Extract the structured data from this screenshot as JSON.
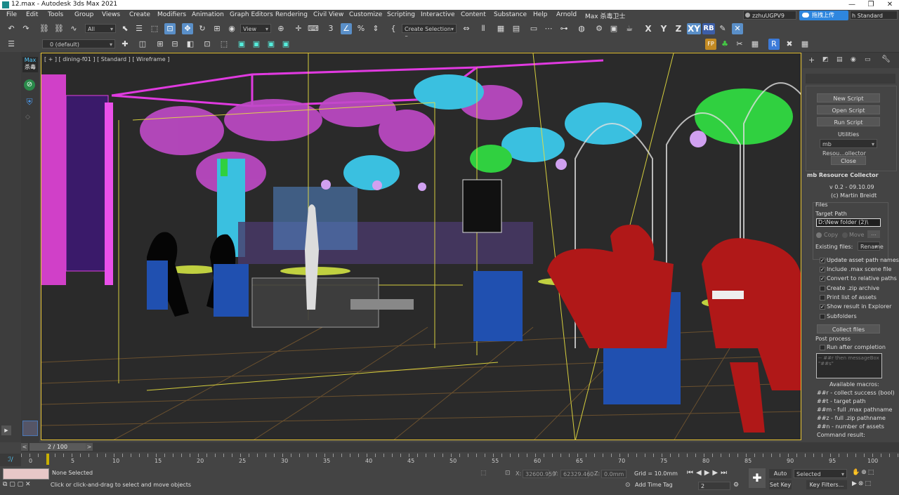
{
  "window": {
    "title": "12.max - Autodesk 3ds Max 2021",
    "min": "—",
    "restore": "❐",
    "close": "✕"
  },
  "menu": [
    "File",
    "Edit",
    "Tools",
    "Group",
    "Views",
    "Create",
    "Modifiers",
    "Animation",
    "Graph Editors",
    "Rendering",
    "Civil View",
    "Customize",
    "Scripting",
    "Interactive",
    "Content",
    "Substance",
    "Help",
    "Arnold",
    "Max 杀毒卫士"
  ],
  "user": {
    "name": "zzhuUGPV9",
    "upload_label": "拖拽上传",
    "workspace": "h Standard"
  },
  "toolbar": {
    "selection_filter": "All",
    "ref_coord": "View",
    "named_selection": "Create Selection Se",
    "axis_x": "X",
    "axis_y": "Y",
    "axis_z": "Z",
    "axis_xy": "XY",
    "rb": "RB",
    "layer_current": "0 (default)"
  },
  "left_strip": {
    "max_label": "Max",
    "antivirus_label": "杀毒"
  },
  "viewport": {
    "label": "[ + ] [ dining-f01 ] [ Standard ] [ Wireframe ]"
  },
  "utility_panel": {
    "new_script": "New Script",
    "open_script": "Open Script",
    "run_script": "Run Script",
    "utilities_label": "Utilities",
    "utilities_selected": "mb Resou...ollector",
    "close": "Close",
    "rollout_title": "mb Resource Collector",
    "version": "v 0.2 - 09.10.09",
    "author": "(c) Martin Breidt",
    "files_label": "Files",
    "target_path_label": "Target Path",
    "target_path_value": "D:\\New folder (2)\\",
    "copy_label": "Copy",
    "move_label": "Move",
    "more_btn": "...",
    "existing_files_label": "Existing files:",
    "existing_files_value": "Rename",
    "options": [
      {
        "label": "Update asset path names",
        "checked": true
      },
      {
        "label": "Include .max scene file",
        "checked": true
      },
      {
        "label": "Convert to relative paths",
        "checked": true
      },
      {
        "label": "Create .zip archive",
        "checked": false
      },
      {
        "label": "Print list of assets",
        "checked": false
      },
      {
        "label": "Show result in Explorer",
        "checked": true
      },
      {
        "label": "Subfolders",
        "checked": false
      }
    ],
    "collect_files": "Collect files",
    "post_process_label": "Post process",
    "run_after_completion": "Run after completion",
    "post_script_placeholder": "-- ##r then messageBox \"##s\"",
    "available_macros_label": "Available macros:",
    "macros": [
      "##r - collect success (bool)",
      "##t - target path",
      "##m - full .max pathname",
      "##z - full .zip pathname",
      "##n - number of assets"
    ],
    "command_result_label": "Command result:"
  },
  "timeline": {
    "frame_label": "2 / 100",
    "ticks": [
      "0",
      "5",
      "10",
      "15",
      "20",
      "25",
      "30",
      "35",
      "40",
      "45",
      "50",
      "55",
      "60",
      "65",
      "70",
      "75",
      "80",
      "85",
      "90",
      "95",
      "100"
    ]
  },
  "status": {
    "selection": "None Selected",
    "prompt": "Click or click-and-drag to select and move objects",
    "x_label": "X:",
    "x_value": "32600.959",
    "y_label": "Y:",
    "y_value": "62329.460",
    "z_label": "Z:",
    "z_value": "0.0mm",
    "grid": "Grid = 10.0mm",
    "add_time_tag": "Add Time Tag",
    "auto_key": "Auto Key",
    "set_key": "Set Key",
    "key_mode": "Selected",
    "key_filters": "Key Filters...",
    "current_frame": "2"
  },
  "colors": {
    "accent": "#5a8fc8",
    "viewport_border": "#e8c534",
    "magenta": "#e040e0",
    "cyan": "#40c8e0",
    "red": "#b01818",
    "blue": "#2050b0",
    "green": "#30d040"
  }
}
